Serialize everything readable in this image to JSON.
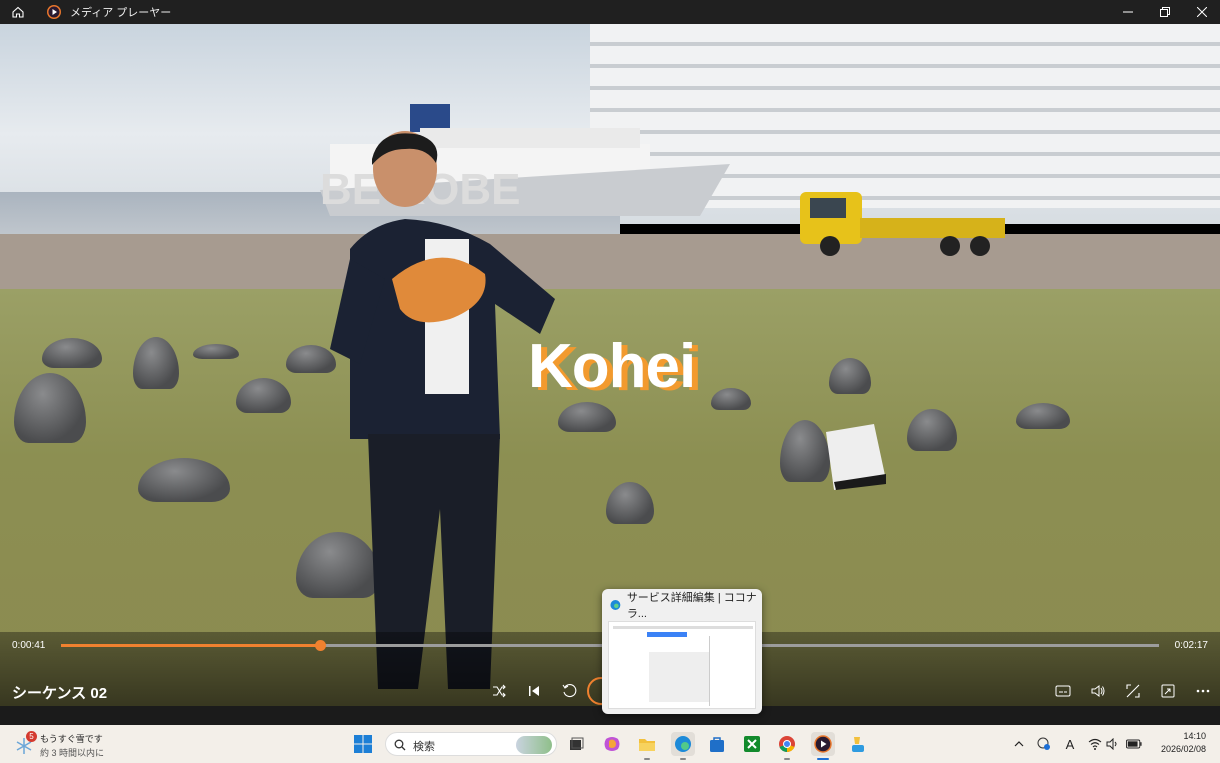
{
  "window": {
    "title": "メディア プレーヤー"
  },
  "video": {
    "overlay_title": "Kohei",
    "sign_text": "BE KOBE"
  },
  "player": {
    "time_elapsed": "0:00:41",
    "time_total": "0:02:17",
    "progress_fraction": 0.236,
    "sequence_title": "シーケンス 02",
    "accent_color": "#f0812f"
  },
  "preview": {
    "title": "サービス詳細編集 | ココナラ..."
  },
  "taskbar": {
    "weather_badge": "5",
    "weather_title": "もうすぐ雪です",
    "weather_sub": "約 3 時間以内に",
    "search_placeholder": "検索",
    "time": "14:10",
    "date": "2026/02/08",
    "ime": "A"
  },
  "icons": [
    "home-icon",
    "media-player-app-icon",
    "minimize-icon",
    "maximize-icon",
    "close-icon",
    "shuffle-icon",
    "previous-icon",
    "rewind-10-icon",
    "play-pause-icon",
    "subtitles-icon",
    "volume-icon",
    "fullscreen-icon",
    "miniplayer-icon",
    "more-icon",
    "windows-start-icon",
    "search-icon",
    "task-view-icon",
    "copilot-icon",
    "file-explorer-icon",
    "edge-icon",
    "store-icon",
    "xbox-icon",
    "chrome-icon",
    "media-player-icon",
    "paint-icon",
    "chevron-up-icon",
    "network-status-icon",
    "wifi-icon",
    "speaker-icon",
    "battery-icon"
  ]
}
